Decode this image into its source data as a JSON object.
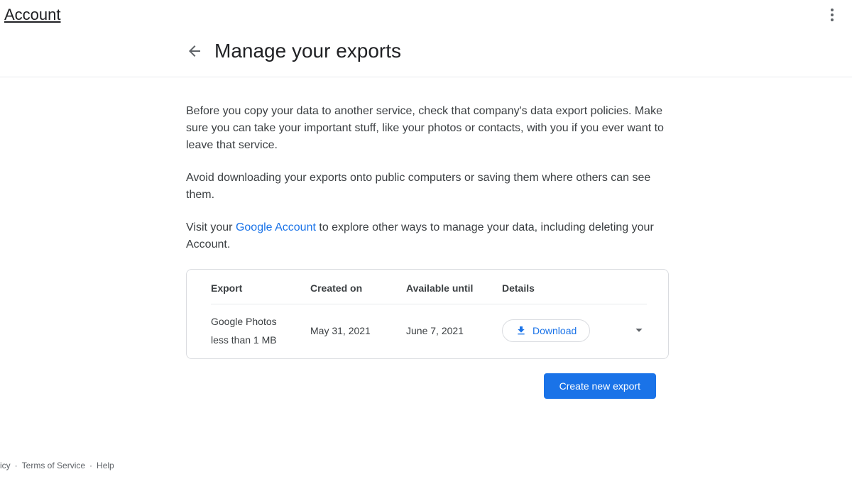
{
  "topbar": {
    "brand": "Account"
  },
  "header": {
    "title": "Manage your exports"
  },
  "intro": {
    "para1": "Before you copy your data to another service, check that company's data export policies. Make sure you can take your important stuff, like your photos or contacts, with you if you ever want to leave that service.",
    "para2": "Avoid downloading your exports onto public computers or saving them where others can see them.",
    "para3_pre": "Visit your ",
    "para3_link": "Google Account",
    "para3_post": " to explore other ways to manage your data, including deleting your Account."
  },
  "table": {
    "headers": {
      "export": "Export",
      "created": "Created on",
      "available": "Available until",
      "details": "Details"
    },
    "rows": [
      {
        "name": "Google Photos",
        "size": "less than 1 MB",
        "created": "May 31, 2021",
        "available": "June 7, 2021",
        "download_label": "Download"
      }
    ]
  },
  "actions": {
    "create_new": "Create new export"
  },
  "footer": {
    "item0_fragment": "icy",
    "item1": "Terms of Service",
    "item2": "Help"
  }
}
